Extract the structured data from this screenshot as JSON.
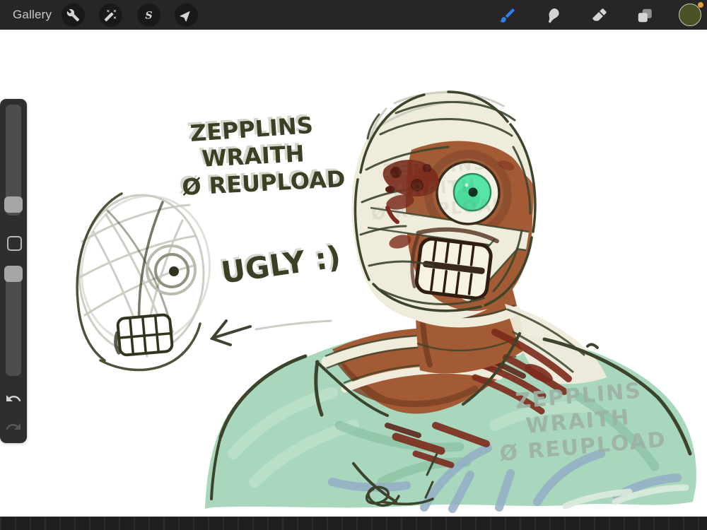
{
  "topbar": {
    "gallery_label": "Gallery",
    "selection_glyph": "S",
    "left_tools": [
      {
        "label": "Actions",
        "icon": "wrench-icon"
      },
      {
        "label": "Adjustments",
        "icon": "magic-wand-icon"
      },
      {
        "label": "Selection",
        "icon": "selection-s-icon"
      },
      {
        "label": "Transform",
        "icon": "transform-arrow-icon"
      }
    ],
    "right_tools": [
      {
        "label": "Paint",
        "icon": "brush-icon",
        "active": true
      },
      {
        "label": "Smudge",
        "icon": "smudge-icon"
      },
      {
        "label": "Erase",
        "icon": "eraser-icon"
      },
      {
        "label": "Layers",
        "icon": "layers-icon"
      },
      {
        "label": "Color",
        "icon": "color-swatch"
      }
    ]
  },
  "sidebar": {
    "controls": [
      "brush-size-slider",
      "modify-button",
      "brush-opacity-slider",
      "undo-button",
      "redo-button"
    ]
  },
  "artwork": {
    "title_lines": [
      "ZEPPLINS",
      "WRAITH",
      "Ø REUPLOAD"
    ],
    "caption": "UGLY :)",
    "watermark_lines": [
      "ZEPPLINS",
      "WRAITH",
      "Ø REUPLOAD"
    ]
  },
  "colors": {
    "bar": "#262626",
    "btn": "#191919",
    "icon": "#d4d4d4",
    "blue": "#2f7ff0",
    "canvas": "#ffffff",
    "sidebar": "#2e2e2e",
    "track": "#4d4d4d",
    "handle": "#a6a6a6",
    "bottombar": "#1f1f1f",
    "swatch": "#4c5226",
    "badge": "#e2a03c",
    "ink": "#394024",
    "inklight": "#c6c9bc",
    "bandage": "#efecdc",
    "skin": "#a35b36",
    "skindark": "#7b4124",
    "blood": "#7c2b1c",
    "blooddark": "#581d12",
    "iris": "#55e6a5",
    "eyewhite": "#f3f1e3",
    "teeth": "#f6f3e2",
    "outline": "#3c452c",
    "shirt": "#a9d7bd",
    "shirtlight": "#c3e4cd",
    "shirtdark": "#84bd9e",
    "shirtblue": "#93aec6",
    "pale": "#ddebdd",
    "watermark": "#9db1a4"
  }
}
